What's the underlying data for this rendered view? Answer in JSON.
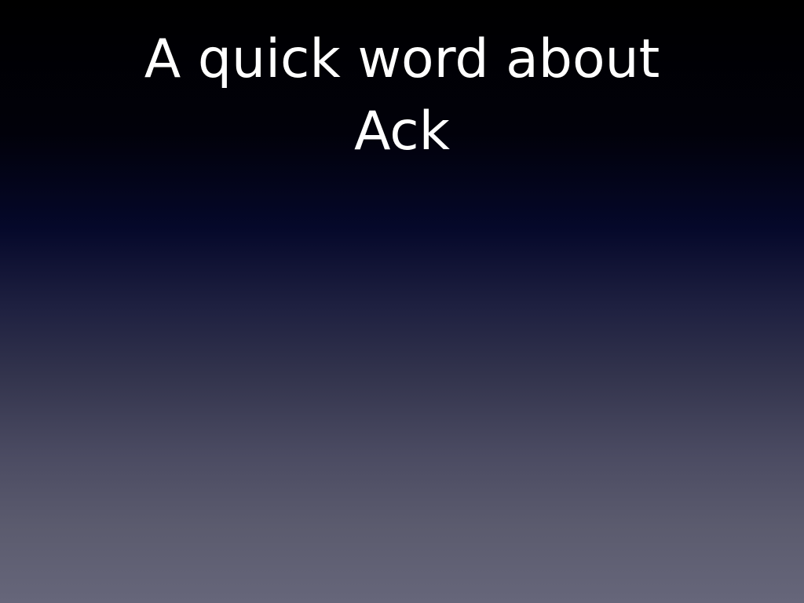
{
  "slide": {
    "title_lines": [
      "A quick word about",
      "Ack"
    ],
    "colors": {
      "title": "#ffffff",
      "background_top": "#000000",
      "background_bottom": "#66667a"
    }
  }
}
